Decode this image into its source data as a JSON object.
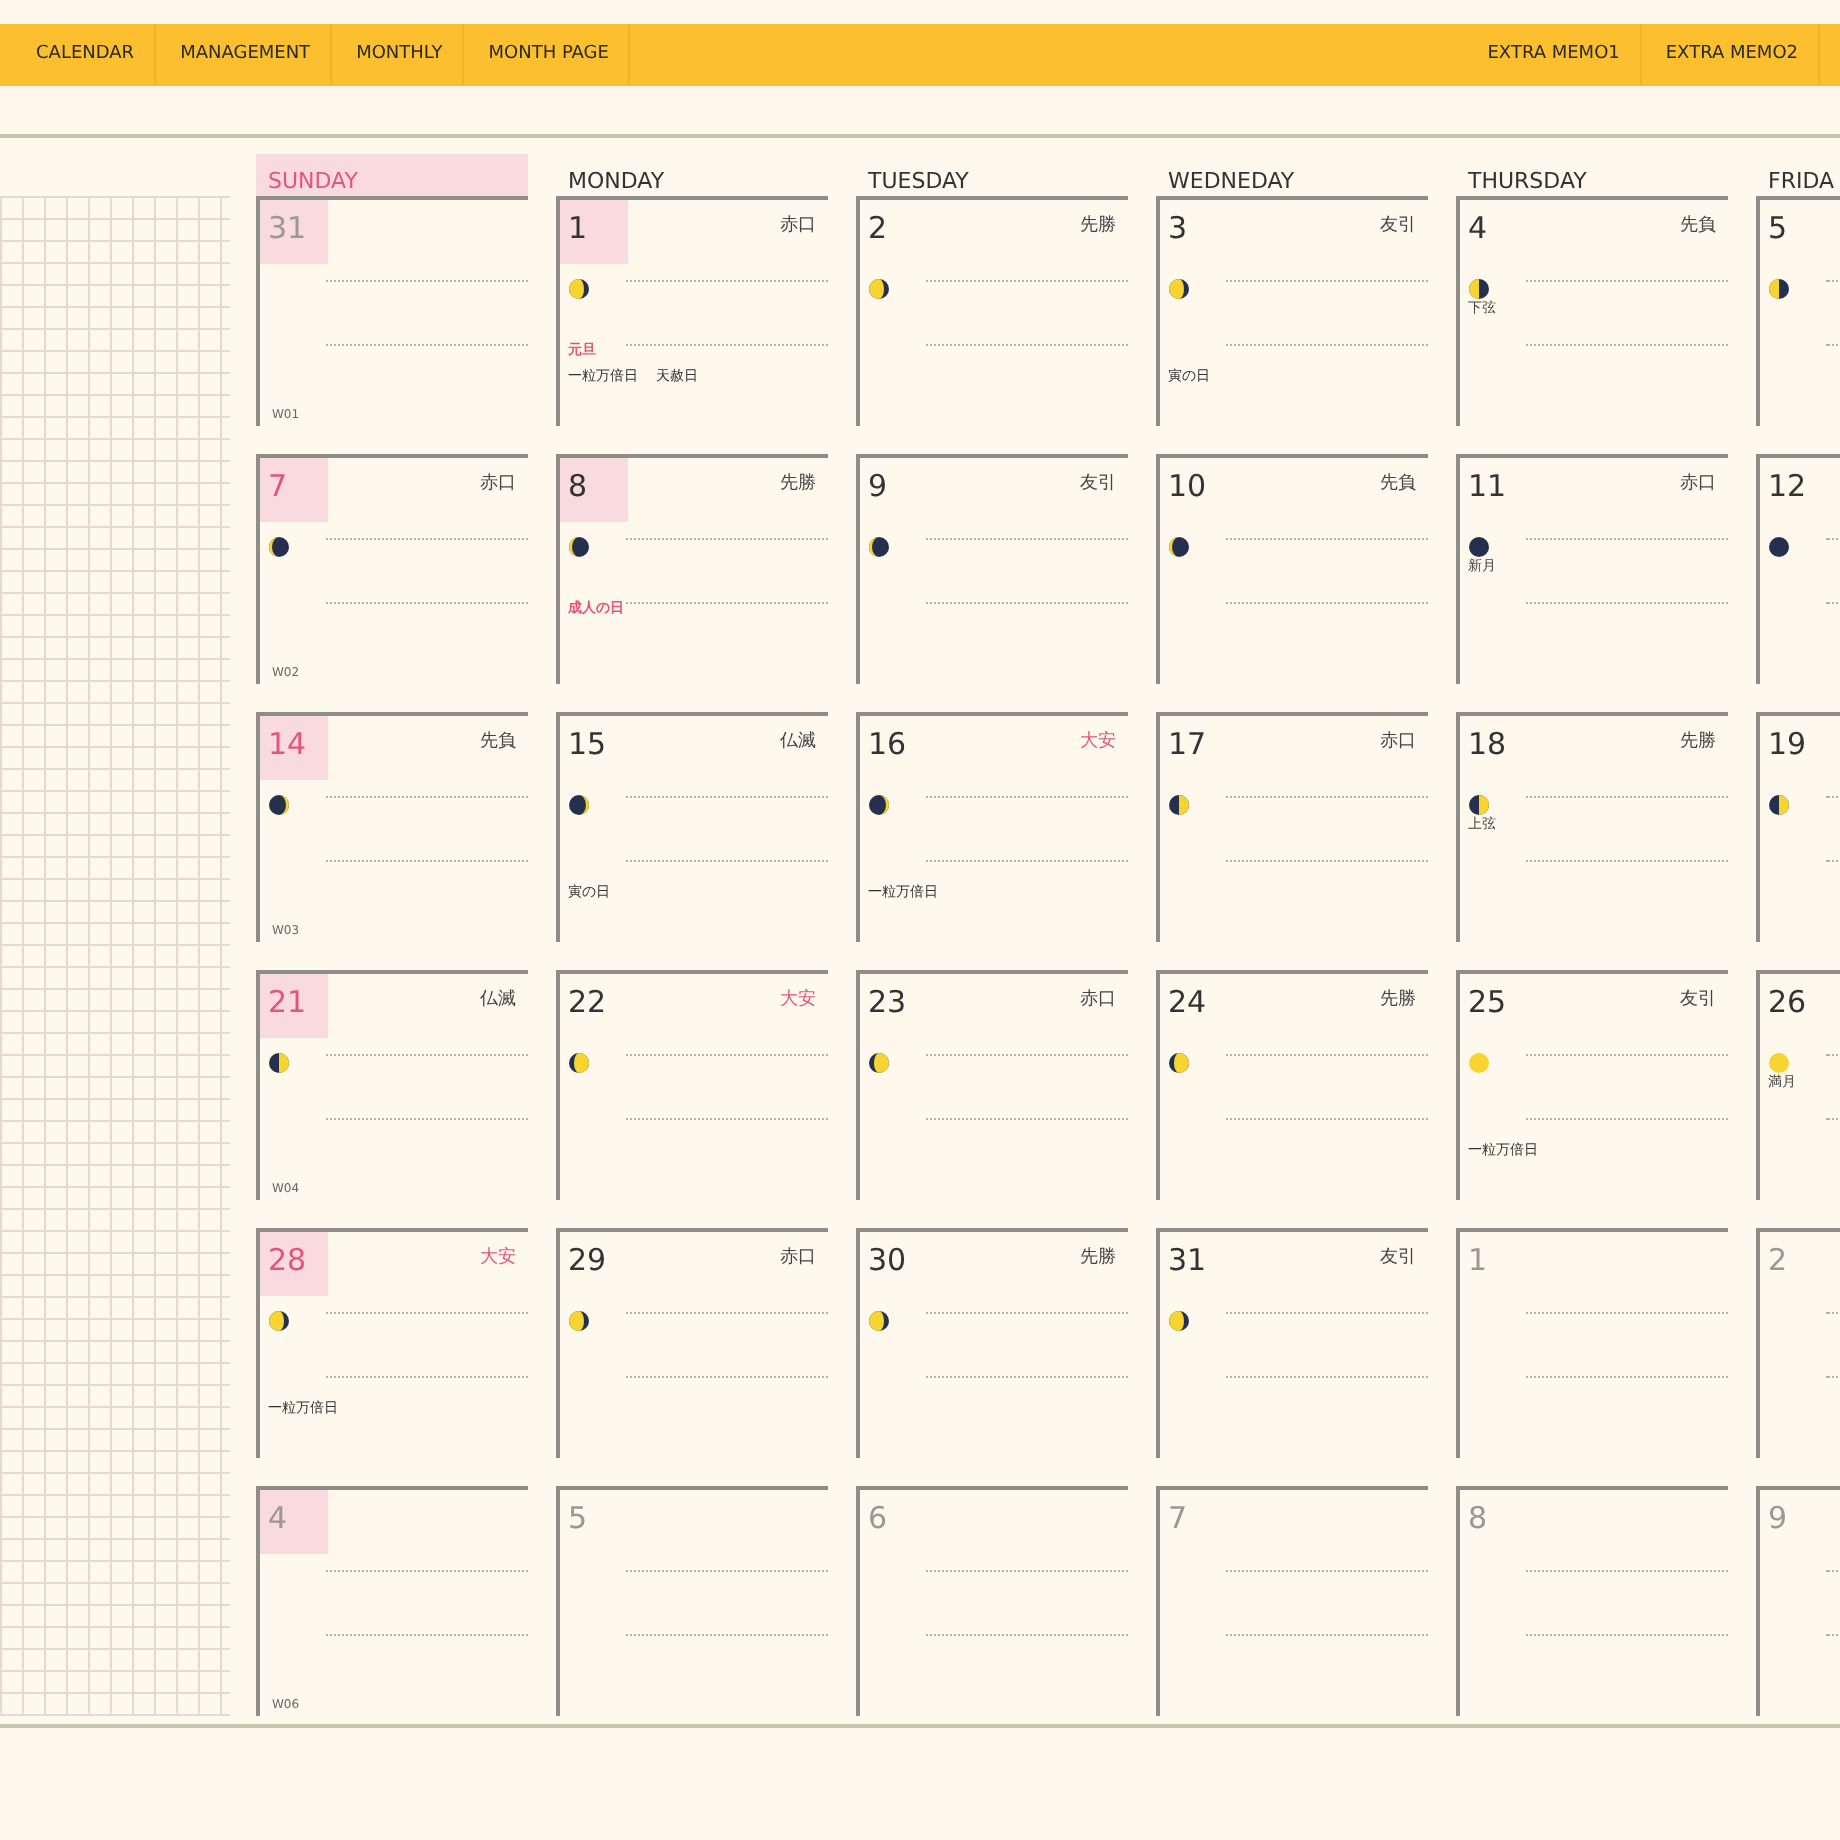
{
  "nav": {
    "left": [
      "CALENDAR",
      "MANAGEMENT",
      "MONTHLY",
      "MONTH PAGE"
    ],
    "right": [
      "EXTRA MEMO1",
      "EXTRA MEMO2"
    ]
  },
  "weekdays": [
    {
      "label": "SUNDAY",
      "highlight": true
    },
    {
      "label": "MONDAY",
      "highlight": false
    },
    {
      "label": "TUESDAY",
      "highlight": false
    },
    {
      "label": "WEDNEDAY",
      "highlight": false
    },
    {
      "label": "THURSDAY",
      "highlight": false
    },
    {
      "label": "FRIDA",
      "highlight": false
    }
  ],
  "weeks": [
    {
      "days": [
        {
          "day": "31",
          "red": false,
          "muted": true,
          "highlight": true,
          "week": "W01"
        },
        {
          "day": "1",
          "red": false,
          "muted": false,
          "highlight": true,
          "rokuyo": {
            "text": "赤口",
            "highlight": false
          },
          "moon": {
            "kind": "gibbous-left"
          },
          "notes": [
            {
              "text": "元旦",
              "kind": "holiday"
            },
            {
              "text": "一粒万倍日",
              "kind": "event"
            },
            {
              "text": "天赦日",
              "kind": "event"
            }
          ]
        },
        {
          "day": "2",
          "red": false,
          "muted": false,
          "highlight": false,
          "rokuyo": {
            "text": "先勝",
            "highlight": false
          },
          "moon": {
            "kind": "gibbous-left"
          }
        },
        {
          "day": "3",
          "red": false,
          "muted": false,
          "highlight": false,
          "rokuyo": {
            "text": "友引",
            "highlight": false
          },
          "moon": {
            "kind": "gibbous-left"
          },
          "notes": [
            {
              "text": "寅の日",
              "kind": "event"
            }
          ]
        },
        {
          "day": "4",
          "red": false,
          "muted": false,
          "highlight": false,
          "rokuyo": {
            "text": "先負",
            "highlight": false
          },
          "moon": {
            "kind": "half-left"
          },
          "moon_label": "下弦"
        },
        {
          "day": "5",
          "red": false,
          "muted": false,
          "highlight": false,
          "moon": {
            "kind": "half-left"
          }
        }
      ]
    },
    {
      "days": [
        {
          "day": "7",
          "red": true,
          "muted": false,
          "highlight": true,
          "rokuyo": {
            "text": "赤口",
            "highlight": false
          },
          "moon": {
            "kind": "crescent-left"
          },
          "week": "W02"
        },
        {
          "day": "8",
          "red": false,
          "muted": false,
          "highlight": true,
          "rokuyo": {
            "text": "先勝",
            "highlight": false
          },
          "moon": {
            "kind": "crescent-left"
          },
          "notes": [
            {
              "text": "成人の日",
              "kind": "holiday"
            }
          ]
        },
        {
          "day": "9",
          "red": false,
          "muted": false,
          "highlight": false,
          "rokuyo": {
            "text": "友引",
            "highlight": false
          },
          "moon": {
            "kind": "crescent-left"
          }
        },
        {
          "day": "10",
          "red": false,
          "muted": false,
          "highlight": false,
          "rokuyo": {
            "text": "先負",
            "highlight": false
          },
          "moon": {
            "kind": "crescent-left"
          }
        },
        {
          "day": "11",
          "red": false,
          "muted": false,
          "highlight": false,
          "rokuyo": {
            "text": "赤口",
            "highlight": false
          },
          "moon": {
            "kind": "new"
          },
          "moon_label": "新月"
        },
        {
          "day": "12",
          "red": false,
          "muted": false,
          "highlight": false,
          "moon": {
            "kind": "new"
          }
        }
      ]
    },
    {
      "days": [
        {
          "day": "14",
          "red": true,
          "muted": false,
          "highlight": true,
          "rokuyo": {
            "text": "先負",
            "highlight": false
          },
          "moon": {
            "kind": "crescent-right"
          },
          "week": "W03"
        },
        {
          "day": "15",
          "red": false,
          "muted": false,
          "highlight": false,
          "rokuyo": {
            "text": "仏滅",
            "highlight": false
          },
          "moon": {
            "kind": "crescent-right"
          },
          "notes": [
            {
              "text": "寅の日",
              "kind": "event"
            }
          ]
        },
        {
          "day": "16",
          "red": false,
          "muted": false,
          "highlight": false,
          "rokuyo": {
            "text": "大安",
            "highlight": true
          },
          "moon": {
            "kind": "crescent-right"
          },
          "notes": [
            {
              "text": "一粒万倍日",
              "kind": "event"
            }
          ]
        },
        {
          "day": "17",
          "red": false,
          "muted": false,
          "highlight": false,
          "rokuyo": {
            "text": "赤口",
            "highlight": false
          },
          "moon": {
            "kind": "half-right"
          }
        },
        {
          "day": "18",
          "red": false,
          "muted": false,
          "highlight": false,
          "rokuyo": {
            "text": "先勝",
            "highlight": false
          },
          "moon": {
            "kind": "half-right"
          },
          "moon_label": "上弦"
        },
        {
          "day": "19",
          "red": false,
          "muted": false,
          "highlight": false,
          "moon": {
            "kind": "half-right"
          }
        }
      ]
    },
    {
      "days": [
        {
          "day": "21",
          "red": true,
          "muted": false,
          "highlight": true,
          "rokuyo": {
            "text": "仏滅",
            "highlight": false
          },
          "moon": {
            "kind": "half-right"
          },
          "week": "W04"
        },
        {
          "day": "22",
          "red": false,
          "muted": false,
          "highlight": false,
          "rokuyo": {
            "text": "大安",
            "highlight": true
          },
          "moon": {
            "kind": "gibbous-right"
          }
        },
        {
          "day": "23",
          "red": false,
          "muted": false,
          "highlight": false,
          "rokuyo": {
            "text": "赤口",
            "highlight": false
          },
          "moon": {
            "kind": "gibbous-right"
          }
        },
        {
          "day": "24",
          "red": false,
          "muted": false,
          "highlight": false,
          "rokuyo": {
            "text": "先勝",
            "highlight": false
          },
          "moon": {
            "kind": "gibbous-right"
          }
        },
        {
          "day": "25",
          "red": false,
          "muted": false,
          "highlight": false,
          "rokuyo": {
            "text": "友引",
            "highlight": false
          },
          "moon": {
            "kind": "full"
          },
          "notes": [
            {
              "text": "一粒万倍日",
              "kind": "event"
            }
          ]
        },
        {
          "day": "26",
          "red": false,
          "muted": false,
          "highlight": false,
          "moon": {
            "kind": "full"
          },
          "moon_label": "満月"
        }
      ]
    },
    {
      "days": [
        {
          "day": "28",
          "red": true,
          "muted": false,
          "highlight": true,
          "rokuyo": {
            "text": "大安",
            "highlight": true
          },
          "moon": {
            "kind": "gibbous-left"
          },
          "notes": [
            {
              "text": "一粒万倍日",
              "kind": "event"
            }
          ]
        },
        {
          "day": "29",
          "red": false,
          "muted": false,
          "highlight": false,
          "rokuyo": {
            "text": "赤口",
            "highlight": false
          },
          "moon": {
            "kind": "gibbous-left"
          }
        },
        {
          "day": "30",
          "red": false,
          "muted": false,
          "highlight": false,
          "rokuyo": {
            "text": "先勝",
            "highlight": false
          },
          "moon": {
            "kind": "gibbous-left"
          }
        },
        {
          "day": "31",
          "red": false,
          "muted": false,
          "highlight": false,
          "rokuyo": {
            "text": "友引",
            "highlight": false
          },
          "moon": {
            "kind": "gibbous-left"
          }
        },
        {
          "day": "1",
          "red": false,
          "muted": true,
          "highlight": false
        },
        {
          "day": "2",
          "red": false,
          "muted": true,
          "highlight": false
        }
      ]
    },
    {
      "days": [
        {
          "day": "4",
          "red": false,
          "muted": true,
          "highlight": true,
          "week": "W06"
        },
        {
          "day": "5",
          "red": false,
          "muted": true,
          "highlight": false
        },
        {
          "day": "6",
          "red": false,
          "muted": true,
          "highlight": false
        },
        {
          "day": "7",
          "red": false,
          "muted": true,
          "highlight": false
        },
        {
          "day": "8",
          "red": false,
          "muted": true,
          "highlight": false
        },
        {
          "day": "9",
          "red": false,
          "muted": true,
          "highlight": false
        }
      ]
    }
  ]
}
